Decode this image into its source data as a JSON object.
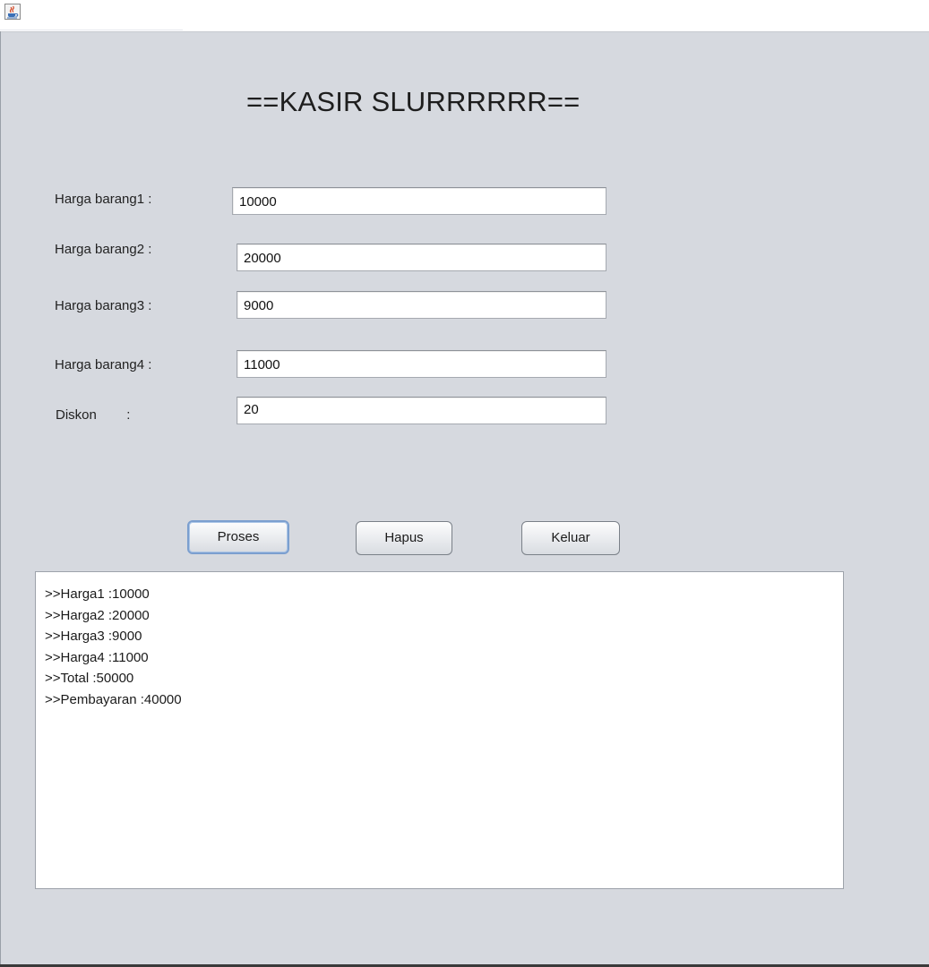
{
  "window": {
    "icon": "java-cup-icon"
  },
  "header": {
    "title": "==KASIR SLURRRRRR=="
  },
  "form": {
    "fields": [
      {
        "label": "Harga barang1 :",
        "value": "10000"
      },
      {
        "label": "Harga barang2 :",
        "value": "20000"
      },
      {
        "label": "Harga barang3 :",
        "value": "9000"
      },
      {
        "label": "Harga barang4 :",
        "value": "11000"
      },
      {
        "label": "Diskon        :",
        "value": "20"
      }
    ]
  },
  "actions": {
    "proses": "Proses",
    "hapus": "Hapus",
    "keluar": "Keluar"
  },
  "output": {
    "lines": [
      ">>Harga1 :10000",
      ">>Harga2 :20000",
      ">>Harga3 :9000",
      ">>Harga4 :11000",
      ">>Total :50000",
      ">>Pembayaran :40000"
    ]
  },
  "colors": {
    "panel_background": "#d6d9df",
    "button_focus_border": "#7b9fcf",
    "field_background": "#ffffff"
  }
}
